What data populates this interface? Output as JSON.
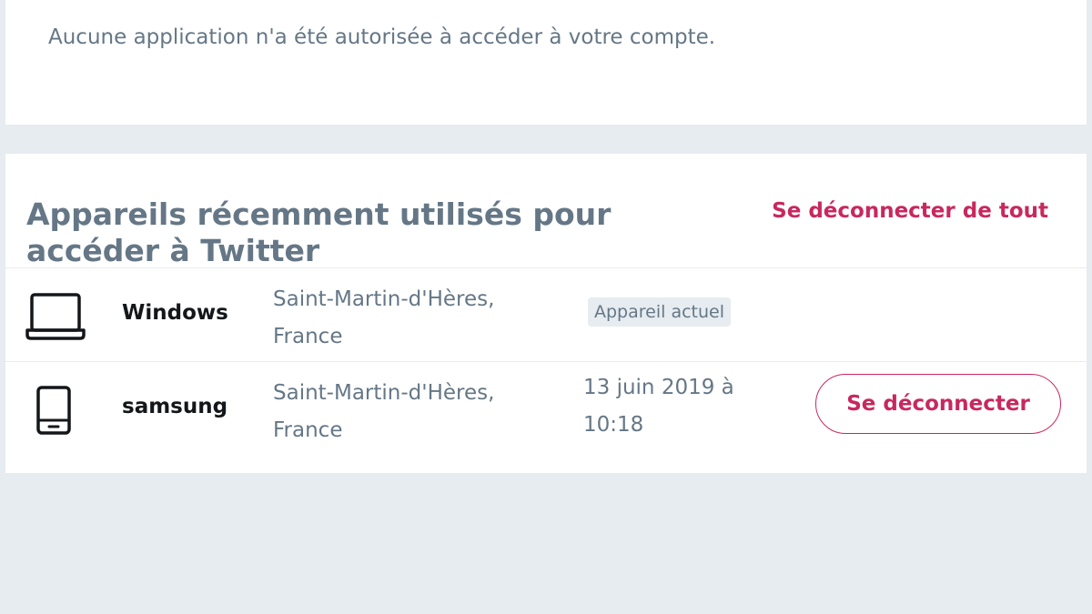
{
  "apps": {
    "empty_message": "Aucune application n'a été autorisée à accéder à votre compte."
  },
  "devices": {
    "title": "Appareils récemment utilisés pour accéder à Twitter",
    "logout_all_label": "Se déconnecter de tout",
    "items": [
      {
        "icon": "laptop-icon",
        "name": "Windows",
        "location_line1": "Saint-Martin-d'Hères,",
        "location_line2": "France",
        "badge": "Appareil actuel"
      },
      {
        "icon": "phone-icon",
        "name": "samsung",
        "location_line1": "Saint-Martin-d'Hères,",
        "location_line2": "France",
        "date_line1": "13 juin 2019 à",
        "date_line2": "10:18",
        "logout_label": "Se déconnecter"
      }
    ]
  },
  "colors": {
    "background": "#e6ecf0",
    "card": "#ffffff",
    "accent": "#c8285e",
    "secondary_text": "#657786",
    "primary_text": "#14171a"
  }
}
